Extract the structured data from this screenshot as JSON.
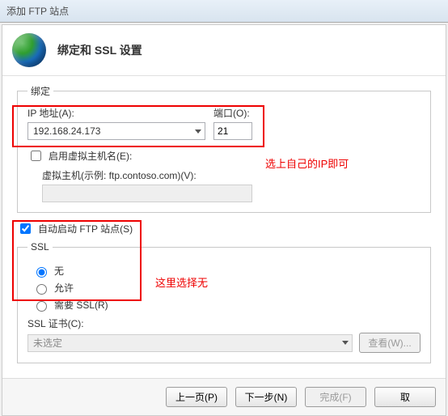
{
  "titlebar": "添加 FTP 站点",
  "header": {
    "title": "绑定和 SSL 设置"
  },
  "binding": {
    "legend": "绑定",
    "ip_label": "IP 地址(A):",
    "ip_value": "192.168.24.173",
    "port_label": "端口(O):",
    "port_value": "21",
    "enable_vhost_label": "启用虚拟主机名(E):",
    "vhost_label": "虚拟主机(示例: ftp.contoso.com)(V):",
    "vhost_value": ""
  },
  "autostart_label": "自动启动 FTP 站点(S)",
  "ssl": {
    "legend": "SSL",
    "none": "无",
    "allow": "允许",
    "require": "需要 SSL(R)",
    "cert_label": "SSL 证书(C):",
    "cert_value": "未选定",
    "view_btn": "查看(W)..."
  },
  "annotations": {
    "ip": "选上自己的IP即可",
    "ssl": "这里选择无"
  },
  "footer": {
    "prev": "上一页(P)",
    "next": "下一步(N)",
    "finish": "完成(F)",
    "cancel": "取"
  }
}
